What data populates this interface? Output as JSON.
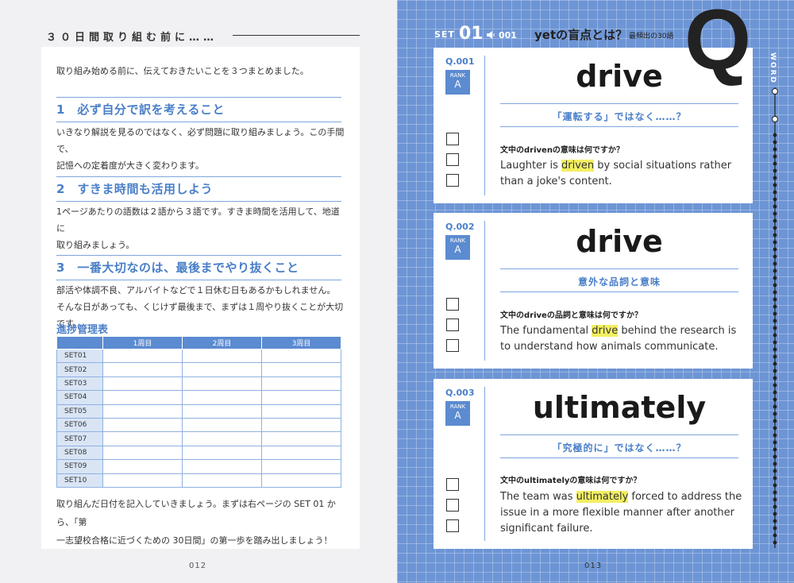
{
  "left": {
    "header": "３０日間取り組む前に……",
    "intro": "取り組み始める前に、伝えておきたいことを３つまとめました。",
    "sections": [
      {
        "title": "1　必ず自分で訳を考えること",
        "lines": [
          "いきなり解説を見るのではなく、必ず問題に取り組みましょう。この手間で、",
          "記憶への定着度が大きく変わります。"
        ]
      },
      {
        "title": "2　すきま時間も活用しよう",
        "lines": [
          "1ページあたりの語数は２語から３語です。すきま時間を活用して、地道に",
          "取り組みましょう。"
        ]
      },
      {
        "title": "3　一番大切なのは、最後までやり抜くこと",
        "lines": [
          "部活や体調不良、アルバイトなどで１日休む日もあるかもしれません。",
          "そんな日があっても、くじけず最後まで、まずは１周やり抜くことが大切です。"
        ]
      }
    ],
    "progress": {
      "title": "進捗管理表",
      "columns": [
        "",
        "1周目",
        "2周目",
        "3周目"
      ],
      "rows": [
        "SET01",
        "SET02",
        "SET03",
        "SET04",
        "SET05",
        "SET06",
        "SET07",
        "SET08",
        "SET09",
        "SET10"
      ]
    },
    "footer_lines": [
      "取り組んだ日付を記入していきましょう。まずは右ページの SET 01 から、「第",
      "一志望校合格に近づくための 30日間」の第一歩を踏み出しましょう！"
    ],
    "page_number": "012"
  },
  "right": {
    "set_label": "SET",
    "set_number": "01",
    "track": "001",
    "title": "yetの盲点とは？",
    "subtitle": "最頻出の30語",
    "big_letter": "Q",
    "side_label": "WORD",
    "cards": [
      {
        "qnum": "Q.001",
        "rank_label": "RANK",
        "rank": "A",
        "word": "drive",
        "hint": "「運転する」ではなく……？",
        "question": "文中のdrivenの意味は何ですか？",
        "sentence_pre": "Laughter is ",
        "sentence_hl": "driven",
        "sentence_post": " by social situations rather than a joke's content."
      },
      {
        "qnum": "Q.002",
        "rank_label": "RANK",
        "rank": "A",
        "word": "drive",
        "hint": "意外な品詞と意味",
        "question": "文中のdriveの品詞と意味は何ですか？",
        "sentence_pre": "The fundamental ",
        "sentence_hl": "drive",
        "sentence_post": " behind the research is to understand how animals communicate."
      },
      {
        "qnum": "Q.003",
        "rank_label": "RANK",
        "rank": "A",
        "word": "ultimately",
        "hint": "「究極的に」ではなく……？",
        "question": "文中のultimatelyの意味は何ですか？",
        "sentence_pre": "The team was ",
        "sentence_hl": "ultimately",
        "sentence_post": " forced to address the issue in a more flexible manner after another significant failure."
      }
    ],
    "page_number": "013"
  },
  "colors": {
    "accent_blue": "#4a7fc8",
    "page_blue": "#6d95d5",
    "highlight": "#f3ef62"
  }
}
